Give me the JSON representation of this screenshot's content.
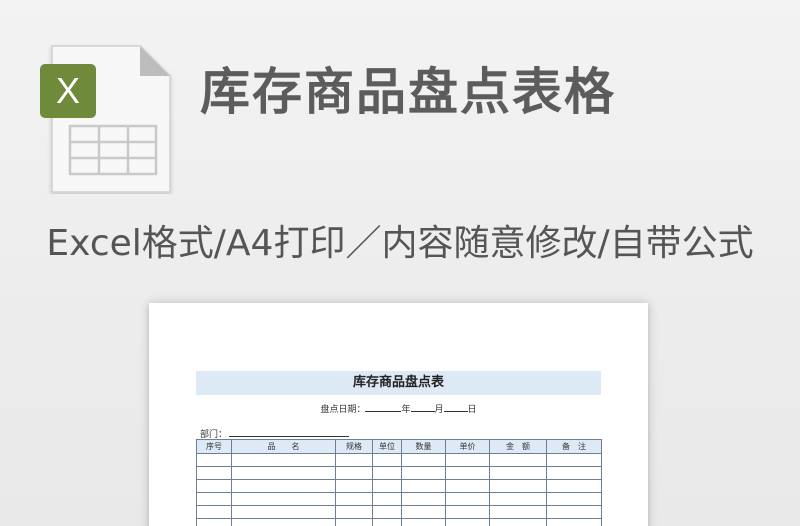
{
  "header": {
    "title": "库存商品盘点表格",
    "subtitle": "Excel格式/A4打印／内容随意修改/自带公式",
    "file_icon": {
      "badge": "X",
      "badge_color": "#6f8a3a",
      "icon": "excel-file-icon"
    }
  },
  "document": {
    "title": "库存商品盘点表",
    "date_label": "盘点日期：",
    "year_label": "年",
    "month_label": "月",
    "day_label": "日",
    "dept_label": "部门：",
    "columns": [
      "序号",
      "品　　名",
      "规格",
      "单位",
      "数量",
      "单价",
      "金　额",
      "备　注"
    ],
    "empty_rows": 6
  }
}
